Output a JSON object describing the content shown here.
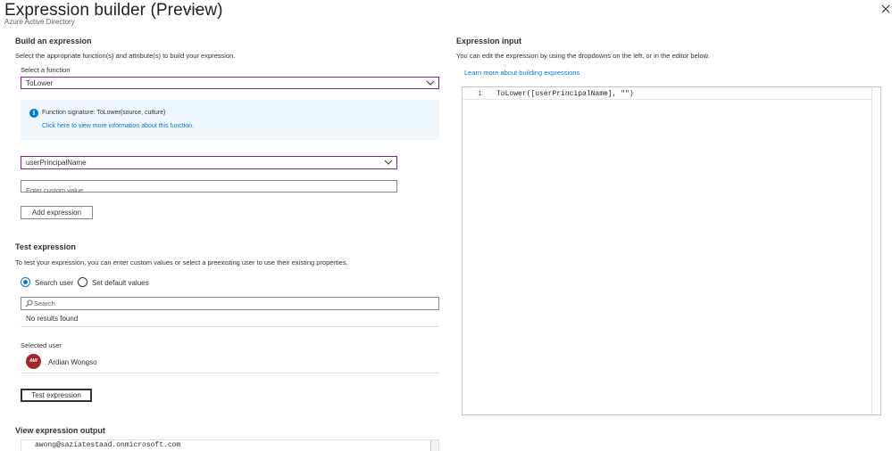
{
  "header": {
    "title": "Expression builder (Preview)",
    "subtitle": "Azure Active Directory",
    "more_label": "···"
  },
  "build": {
    "heading": "Build an expression",
    "description": "Select the appropriate function(s) and attribute(s) to build your expression.",
    "function_label": "Select a function",
    "function_value": "ToLower",
    "info_signature": "Function signature: ToLower(source, culture)",
    "info_link": "Click here to view more information about this function.",
    "attribute_value": "userPrincipalName",
    "custom_value_placeholder": "Enter custom value",
    "add_button": "Add expression"
  },
  "test": {
    "heading": "Test expression",
    "description": "To test your expression, you can enter custom values or select a preexisting user to use their existing properties.",
    "radio_search": "Search user",
    "radio_default": "Set default values",
    "selected_option": "search",
    "search_placeholder": "Search",
    "no_results": "No results found",
    "selected_user_label": "Selected user",
    "user_initials": "AW",
    "user_name": "Ardian Wongso",
    "test_button": "Test expression"
  },
  "output": {
    "heading": "View expression output",
    "value": "awong@saziatestaad.onmicrosoft.com"
  },
  "input": {
    "heading": "Expression input",
    "description": "You can edit the expression by using the dropdowns on the left, or in the editor below.",
    "learn_link": "Learn more about building expressions",
    "line_number": "1",
    "code": "ToLower([userPrincipalName], \"\")"
  },
  "colors": {
    "accent": "#0078d4",
    "dropdown_border": "#8a1f86",
    "avatar_bg": "#a4262c",
    "info_bg": "#eff6fc"
  }
}
